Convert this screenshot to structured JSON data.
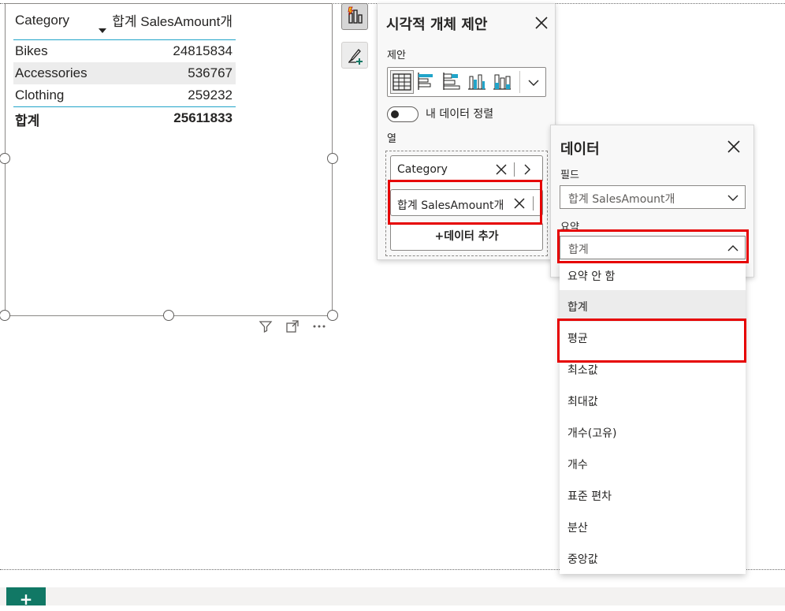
{
  "table": {
    "headers": [
      "Category",
      "합계 SalesAmount개"
    ],
    "rows": [
      {
        "category": "Bikes",
        "value": "24815834"
      },
      {
        "category": "Accessories",
        "value": "536767"
      },
      {
        "category": "Clothing",
        "value": "259232"
      }
    ],
    "total": {
      "label": "합계",
      "value": "25611833"
    }
  },
  "icons": {
    "filter": "filter-icon",
    "focus": "focus-mode-icon",
    "more": "more-options-icon",
    "suggest": "visual-suggestion-icon",
    "format": "format-brush-icon"
  },
  "suggest_panel": {
    "title": "시각적 개체 제안",
    "suggestions_label": "제안",
    "toggle_label": "내 데이터 정렬",
    "columns_label": "열",
    "fields": [
      "Category",
      "합계 SalesAmount개"
    ],
    "add_data": "+데이터 추가"
  },
  "data_panel": {
    "title": "데이터",
    "field_label": "필드",
    "field_value": "합계 SalesAmount개",
    "summarize_label": "요약",
    "summarize_value": "합계"
  },
  "summarize_options": [
    "요약 안 함",
    "합계",
    "평균",
    "최소값",
    "최대값",
    "개수(고유)",
    "개수",
    "표준 편차",
    "분산",
    "중앙값"
  ],
  "bottom": {
    "add_page": "+"
  },
  "colors": {
    "accent": "#21a4c9",
    "highlight": "#e60000",
    "brand_green": "#117865"
  }
}
